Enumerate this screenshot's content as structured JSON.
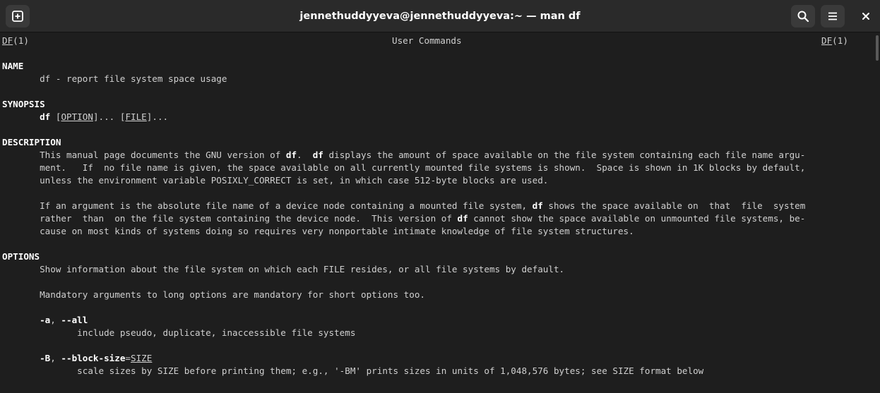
{
  "window": {
    "title": "jennethuddyyeva@jennethuddyyeva:~ — man df",
    "buttons": {
      "new_tab": "new-tab-icon",
      "search": "search-icon",
      "menu": "hamburger-menu-icon",
      "close": "close-icon"
    }
  },
  "man": {
    "header_left_name": "DF",
    "header_left_section": "(1)",
    "header_center": "User Commands",
    "header_right_name": "DF",
    "header_right_section": "(1)",
    "name_heading": "NAME",
    "name_text": "df - report file system space usage",
    "synopsis_heading": "SYNOPSIS",
    "synopsis_cmd": "df",
    "synopsis_open1": "[",
    "synopsis_option": "OPTION",
    "synopsis_close1": "]... [",
    "synopsis_file": "FILE",
    "synopsis_close2": "]...",
    "description_heading": "DESCRIPTION",
    "desc1_a": "This manual page documents the GNU version of ",
    "desc1_b": "df",
    "desc1_c": ".  ",
    "desc1_d": "df",
    "desc1_e": " displays the amount of space available on the file system containing each file name argu-",
    "desc2": "ment.   If  no file name is given, the space available on all currently mounted file systems is shown.  Space is shown in 1K blocks by default,",
    "desc3": "unless the environment variable POSIXLY_CORRECT is set, in which case 512-byte blocks are used.",
    "desc4_a": "If an argument is the absolute file name of a device node containing a mounted file system, ",
    "desc4_b": "df",
    "desc4_c": " shows the space available on  that  file  system",
    "desc5_a": "rather  than  on the file system containing the device node.  This version of ",
    "desc5_b": "df",
    "desc5_c": " cannot show the space available on unmounted file systems, be-",
    "desc6": "cause on most kinds of systems doing so requires very nonportable intimate knowledge of file system structures.",
    "options_heading": "OPTIONS",
    "opt_intro": "Show information about the file system on which each FILE resides, or all file systems by default.",
    "opt_mandatory": "Mandatory arguments to long options are mandatory for short options too.",
    "opt_a_short": "-a",
    "opt_a_sep": ", ",
    "opt_a_long": "--all",
    "opt_a_desc": "include pseudo, duplicate, inaccessible file systems",
    "opt_b_short": "-B",
    "opt_b_sep": ", ",
    "opt_b_long": "--block-size",
    "opt_b_eq": "=",
    "opt_b_arg": "SIZE",
    "opt_b_desc": "scale sizes by SIZE before printing them; e.g., '-BM' prints sizes in units of 1,048,576 bytes; see SIZE format below"
  }
}
